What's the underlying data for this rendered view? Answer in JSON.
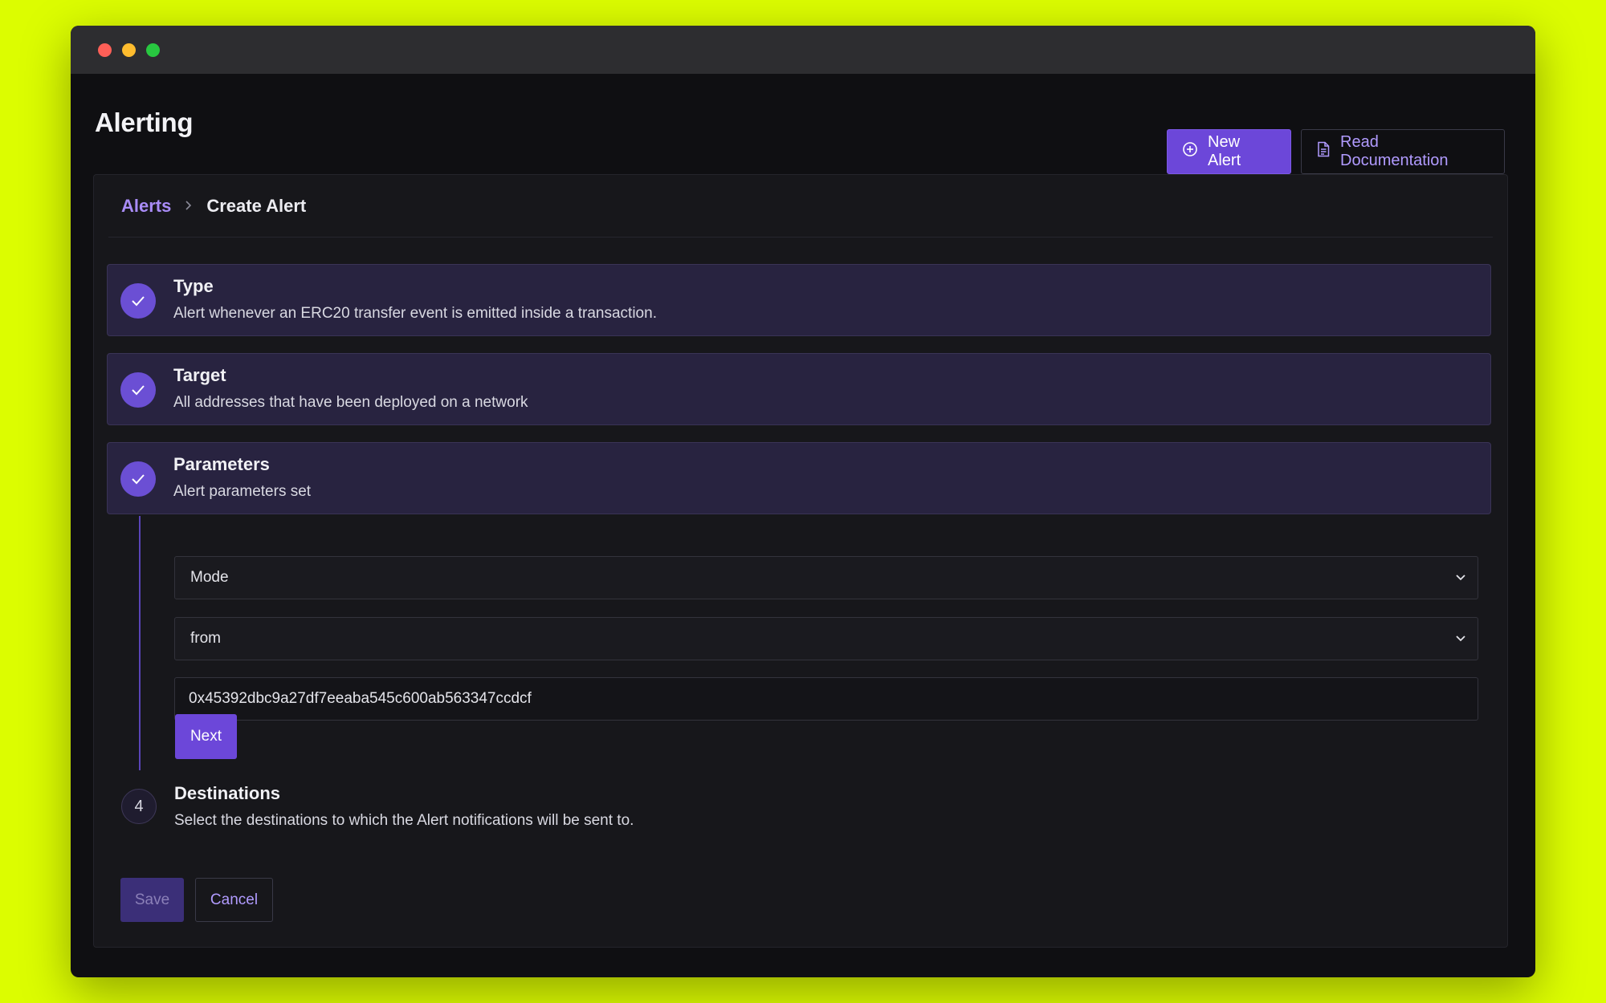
{
  "window": {
    "controls": [
      "close",
      "minimize",
      "maximize"
    ]
  },
  "header": {
    "title": "Alerting",
    "new_alert_label": "New Alert",
    "read_docs_label": "Read Documentation"
  },
  "breadcrumb": {
    "parent": "Alerts",
    "current": "Create Alert"
  },
  "steps": [
    {
      "title": "Type",
      "description": "Alert whenever an ERC20 transfer event is emitted inside a transaction.",
      "status": "complete"
    },
    {
      "title": "Target",
      "description": "All addresses that have been deployed on a network",
      "status": "complete"
    },
    {
      "title": "Parameters",
      "description": "Alert parameters set",
      "status": "complete"
    },
    {
      "number": "4",
      "title": "Destinations",
      "description": "Select the destinations to which the Alert notifications will be sent to.",
      "status": "pending"
    }
  ],
  "parameters": {
    "mode_value": "Mode",
    "direction_value": "from",
    "address_value": "0x45392dbc9a27df7eeaba545c600ab563347ccdcf",
    "next_label": "Next"
  },
  "footer": {
    "save_label": "Save",
    "cancel_label": "Cancel"
  },
  "colors": {
    "background": "#dcfd00",
    "accent": "#6c47d9",
    "link": "#a98cf7",
    "window": "#0f0f12"
  }
}
